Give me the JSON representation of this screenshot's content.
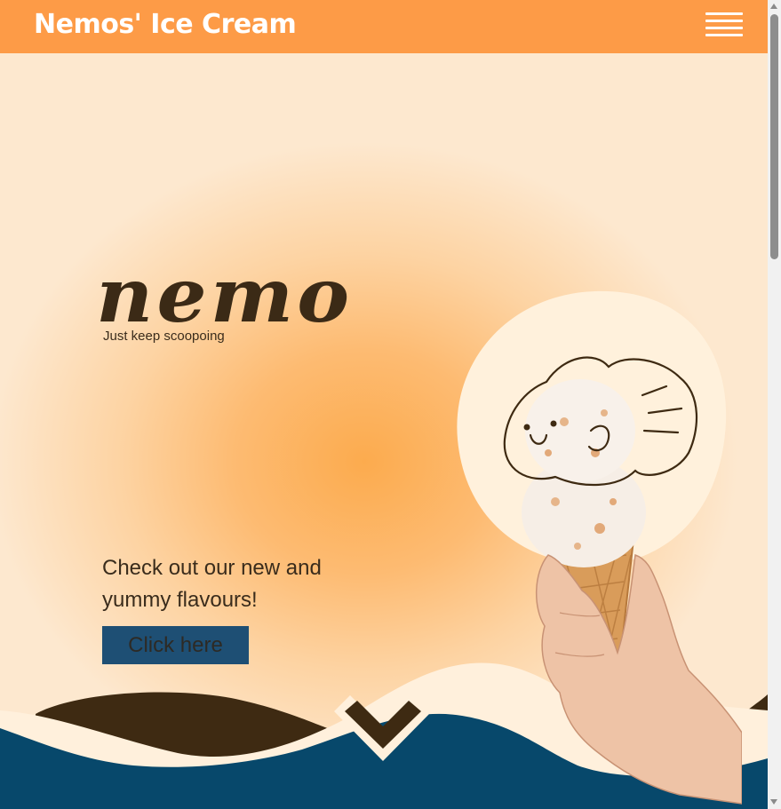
{
  "header": {
    "title": "Nemos' Ice Cream",
    "menu_icon": "hamburger-menu-icon"
  },
  "hero": {
    "logo_text": "nemo",
    "tagline": "Just keep scoopoing",
    "promo_text": "Check out our new and yummy flavours!",
    "cta_label": "Click here",
    "scroll_icon": "chevron-down-icon"
  },
  "colors": {
    "header": "#fd9b47",
    "hero_center": "#fcab4e",
    "hero_edge": "#fde8cf",
    "button": "#1e4f74",
    "wave_dark": "#3e2a12",
    "wave_blue": "#07486b",
    "cream": "#fff0dc"
  }
}
